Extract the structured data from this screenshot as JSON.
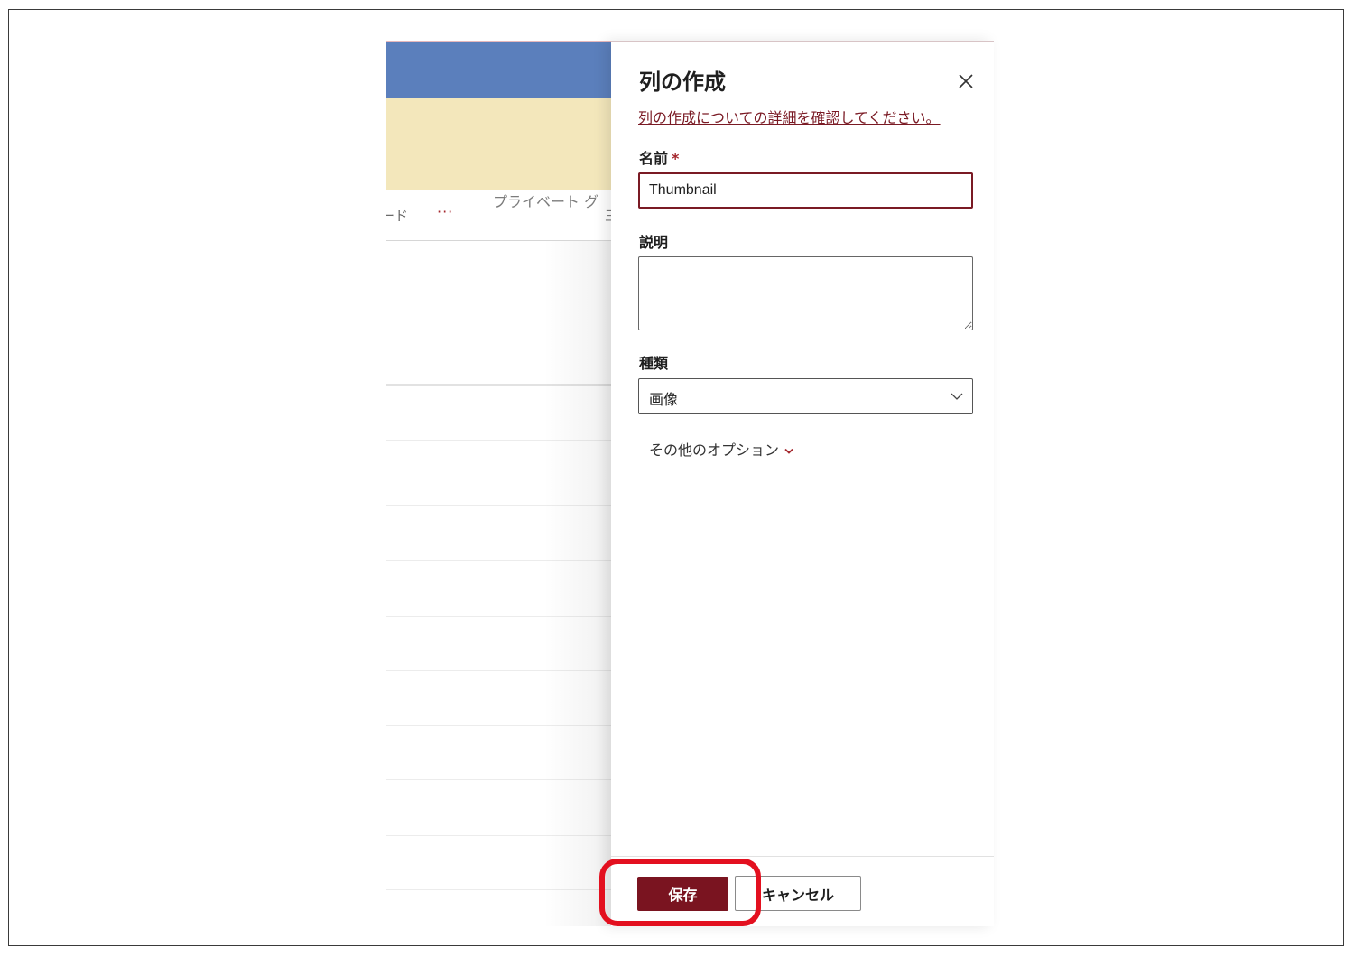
{
  "background": {
    "banner_text": "プライベート グ",
    "command_text": "ード",
    "more_glyph": "···",
    "edge_glyph": "三"
  },
  "panel": {
    "title": "列の作成",
    "learn_more_link": "列の作成についての詳細を確認してください。",
    "name_label": "名前",
    "required_mark": "*",
    "name_value": "Thumbnail",
    "description_label": "説明",
    "description_value": "",
    "type_label": "種類",
    "type_value": "画像",
    "more_options_label": "その他のオプション",
    "save_label": "保存",
    "cancel_label": "キャンセル"
  },
  "colors": {
    "accent": "#7a1420",
    "header_blue": "#5b7fbc",
    "banner_yellow": "#f3e7bb",
    "highlight_red": "#e3101f"
  },
  "icons": {
    "close": "close-icon",
    "type_dropdown": "chevron-down-icon",
    "more_options": "chevron-down-icon"
  }
}
